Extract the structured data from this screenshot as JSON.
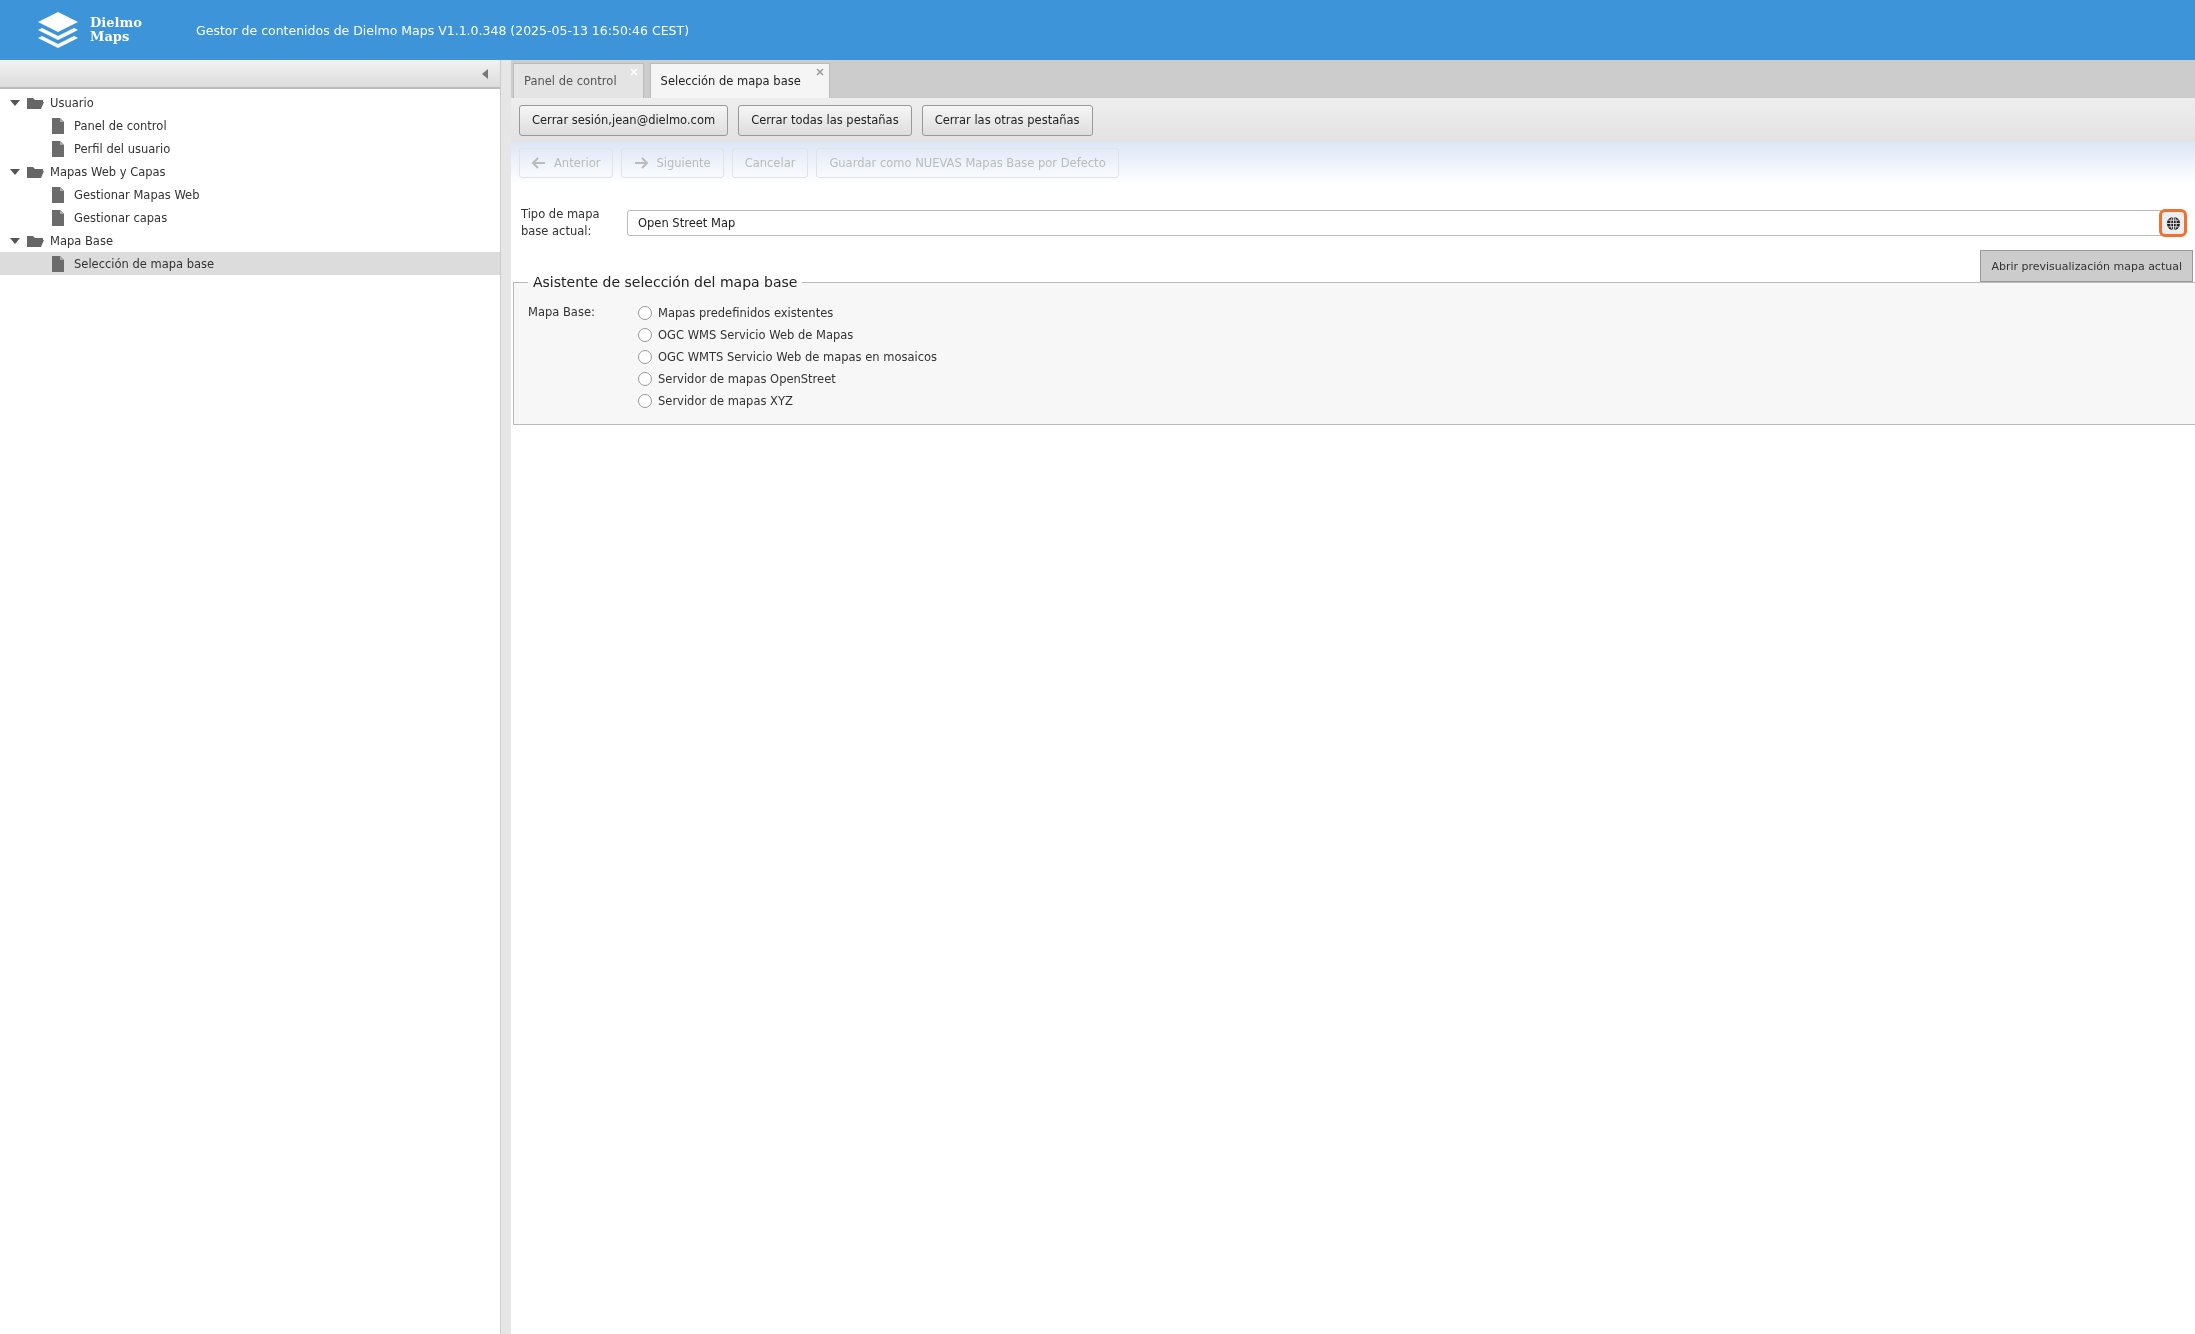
{
  "header": {
    "logo_text": [
      "Dielmo",
      "Maps"
    ],
    "title": "Gestor de contenidos de Dielmo Maps V1.1.0.348 (2025-05-13 16:50:46 CEST)"
  },
  "sidebar": {
    "tree": [
      {
        "label": "Usuario",
        "expanded": true,
        "selected": false,
        "children": [
          {
            "label": "Panel de control",
            "selected": false
          },
          {
            "label": "Perfil del usuario",
            "selected": false
          }
        ]
      },
      {
        "label": "Mapas Web y Capas",
        "expanded": true,
        "selected": false,
        "children": [
          {
            "label": "Gestionar Mapas Web",
            "selected": false
          },
          {
            "label": "Gestionar capas",
            "selected": false
          }
        ]
      },
      {
        "label": "Mapa Base",
        "expanded": true,
        "selected": false,
        "children": [
          {
            "label": "Selección de mapa base",
            "selected": true
          }
        ]
      }
    ]
  },
  "tabs": [
    {
      "label": "Panel de control",
      "selected": false
    },
    {
      "label": "Selección de mapa base",
      "selected": true
    }
  ],
  "toolbar": [
    "Cerrar sesión,jean@dielmo.com",
    "Cerrar todas las pestañas",
    "Cerrar las otras pestañas"
  ],
  "wizard_buttons": [
    {
      "label": "Anterior",
      "kind": "back",
      "disabled": true
    },
    {
      "label": "Siguiente",
      "kind": "next",
      "disabled": true
    },
    {
      "label": "Cancelar",
      "kind": "plain",
      "disabled": true
    },
    {
      "label": "Guardar como NUEVAS Mapas Base por Defecto",
      "kind": "plain",
      "disabled": true
    }
  ],
  "current_map": {
    "label": "Tipo de mapa base actual:",
    "value": "Open Street Map",
    "tooltip": "Abrir previsualización mapa actual"
  },
  "wizard": {
    "legend": "Asistente de selección del mapa base",
    "label": "Mapa Base:",
    "options": [
      {
        "label": "Mapas predefinidos existentes",
        "selected": false
      },
      {
        "label": "OGC WMS Servicio Web de Mapas",
        "selected": false
      },
      {
        "label": "OGC WMTS Servicio Web de mapas en mosaicos",
        "selected": false
      },
      {
        "label": "Servidor de mapas OpenStreet",
        "selected": false
      },
      {
        "label": "Servidor de mapas XYZ",
        "selected": false
      }
    ]
  }
}
